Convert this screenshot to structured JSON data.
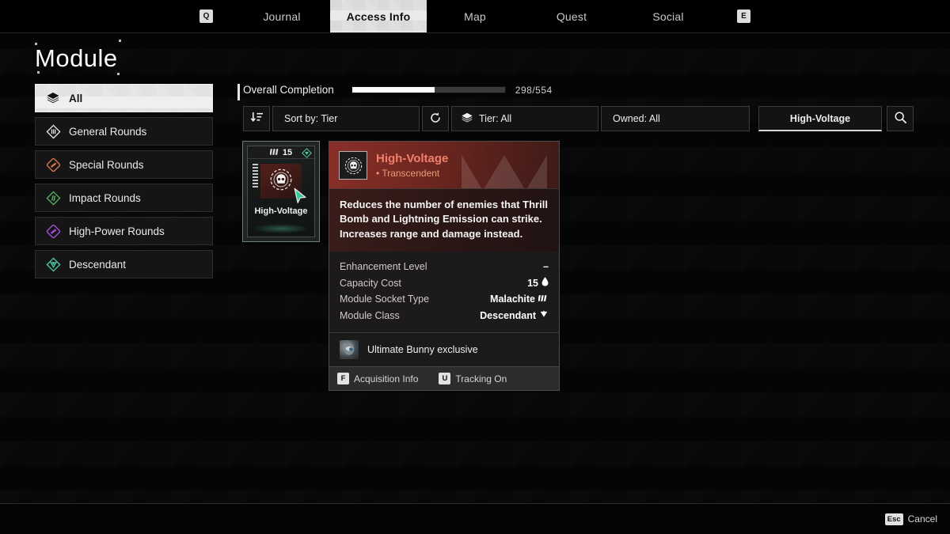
{
  "nav": {
    "left_key": "Q",
    "right_key": "E",
    "tabs": [
      {
        "label": "Journal",
        "active": false
      },
      {
        "label": "Access Info",
        "active": true
      },
      {
        "label": "Map",
        "active": false
      },
      {
        "label": "Quest",
        "active": false
      },
      {
        "label": "Social",
        "active": false
      }
    ]
  },
  "page": {
    "title": "Module"
  },
  "sidebar": {
    "items": [
      {
        "label": "All",
        "icon": "layers-icon",
        "color": "#111111",
        "active": true
      },
      {
        "label": "General Rounds",
        "icon": "general-rounds-icon",
        "color": "#e8e8e8",
        "active": false
      },
      {
        "label": "Special Rounds",
        "icon": "special-rounds-icon",
        "color": "#d4764a",
        "active": false
      },
      {
        "label": "Impact Rounds",
        "icon": "impact-rounds-icon",
        "color": "#58b45e",
        "active": false
      },
      {
        "label": "High-Power Rounds",
        "icon": "high-power-rounds-icon",
        "color": "#a14fd6",
        "active": false
      },
      {
        "label": "Descendant",
        "icon": "descendant-icon",
        "color": "#4fc9a8",
        "active": false
      }
    ]
  },
  "completion": {
    "label": "Overall Completion",
    "current": 298,
    "total": 554,
    "count_text": "298/554",
    "percent": 53.8
  },
  "filters": {
    "sort_icon": "sort-descending-icon",
    "sort_label": "Sort by: Tier",
    "reset_icon": "reset-icon",
    "tier_icon": "layers-icon",
    "tier_label": "Tier: All",
    "owned_label": "Owned: All",
    "search_value": "High-Voltage",
    "search_placeholder": "Search",
    "search_icon": "search-icon"
  },
  "card": {
    "capacity": "15",
    "socket_icon": "malachite-socket-icon",
    "class_badge_icon": "descendant-class-icon",
    "emblem_icon": "skull-emblem-icon",
    "name": "High-Voltage",
    "accent": "#5adcaa"
  },
  "tooltip": {
    "title": "High-Voltage",
    "tier": "• Transcendent",
    "icon": "skull-emblem-icon",
    "description": "Reduces the number of enemies that Thrill Bomb and Lightning Emission can strike. Increases range and damage instead.",
    "stats": [
      {
        "key": "Enhancement Level",
        "value": "–",
        "icon": ""
      },
      {
        "key": "Capacity Cost",
        "value": "15",
        "icon": "capacity-drop-icon"
      },
      {
        "key": "Module Socket Type",
        "value": "Malachite",
        "icon": "malachite-socket-icon"
      },
      {
        "key": "Module Class",
        "value": "Descendant",
        "icon": "descendant-class-icon"
      }
    ],
    "exclusive": {
      "label": "Ultimate Bunny exclusive",
      "avatar_icon": "descendant-portrait-icon"
    },
    "keys": [
      {
        "key": "F",
        "label": "Acquisition Info"
      },
      {
        "key": "U",
        "label": "Tracking On"
      }
    ],
    "title_color": "#f07f6c",
    "tier_color": "#e79e72"
  },
  "bottom": {
    "key": "Esc",
    "label": "Cancel"
  }
}
